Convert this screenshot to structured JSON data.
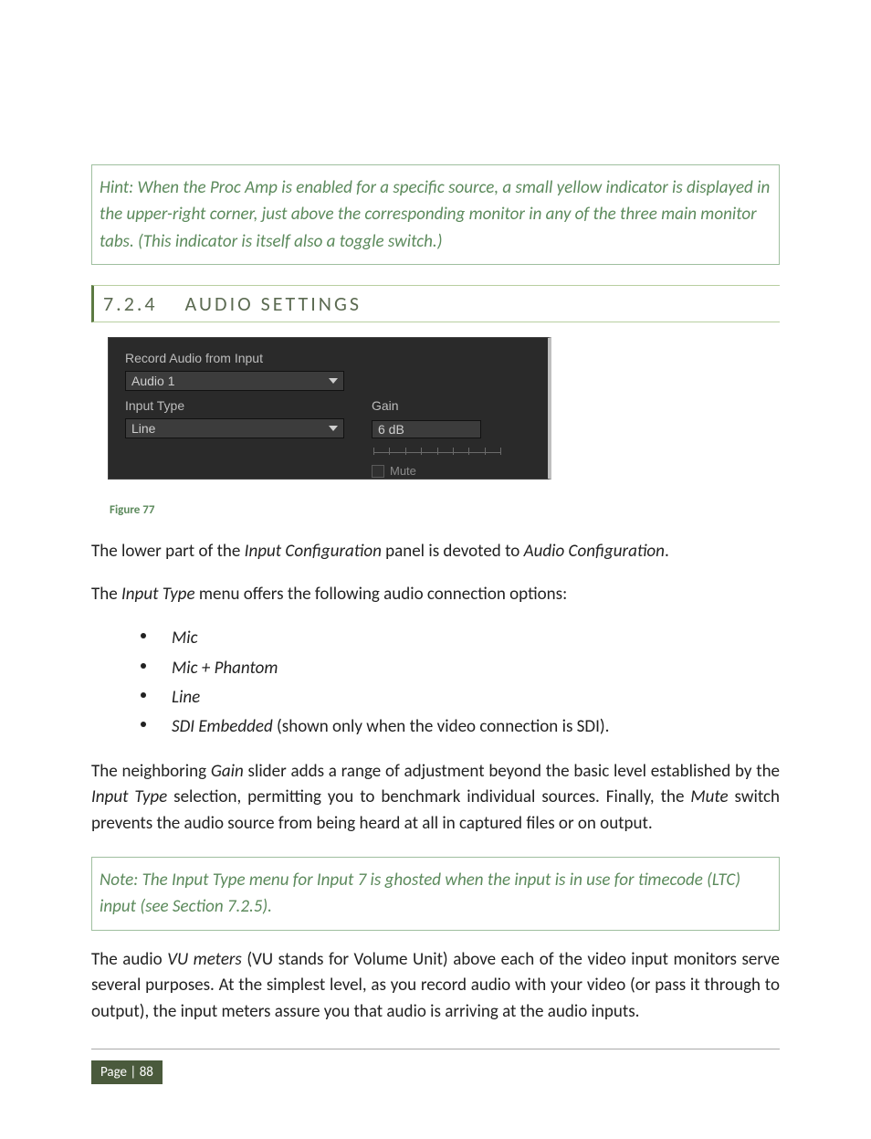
{
  "hint": {
    "text": "Hint: When the Proc Amp is enabled for a specific source, a small yellow indicator is displayed in the upper-right corner, just above the corresponding monitor in any of the three main monitor tabs.  (This indicator is itself also a toggle switch.)"
  },
  "section": {
    "number": "7.2.4",
    "title": "AUDIO SETTINGS"
  },
  "screenshot": {
    "title": "Record Audio from Input",
    "audio_select": "Audio 1",
    "input_type_label": "Input Type",
    "input_type_value": "Line",
    "gain_label": "Gain",
    "gain_value": "6 dB",
    "mute_label": "Mute"
  },
  "figure": {
    "caption": "Figure 77"
  },
  "para1": {
    "prefix": "The lower part of the ",
    "em1": "Input Configuration",
    "mid": " panel is devoted to ",
    "em2": "Audio Configuration",
    "suffix": "."
  },
  "para2": {
    "prefix": "The ",
    "em1": "Input Type",
    "suffix": " menu offers the following audio connection options:"
  },
  "options": {
    "o1": "Mic",
    "o2": "Mic + Phantom",
    "o3": "Line",
    "o4_em": "SDI Embedded",
    "o4_rest": " (shown only when the video connection is SDI)."
  },
  "para3": {
    "t0": "The neighboring ",
    "em1": "Gain",
    "t1": " slider adds a range of adjustment beyond the basic level established by the ",
    "em2": "Input Type",
    "t2": " selection, permitting you to benchmark individual sources.  Finally, the ",
    "em3": "Mute",
    "t3": " switch prevents the audio source from being heard at all in captured files or on output."
  },
  "note": {
    "text": "Note: The Input Type menu for Input 7 is ghosted when the input is in use for timecode (LTC) input (see Section 7.2.5)."
  },
  "para4": {
    "t0": "The audio ",
    "em1": "VU meters",
    "t1": " (VU stands for Volume Unit) above each of the video input monitors serve several purposes.  At the simplest level, as you record audio with your video (or pass it through to output), the input meters assure you that audio is arriving at the audio inputs."
  },
  "footer": {
    "page": "Page | 88"
  }
}
